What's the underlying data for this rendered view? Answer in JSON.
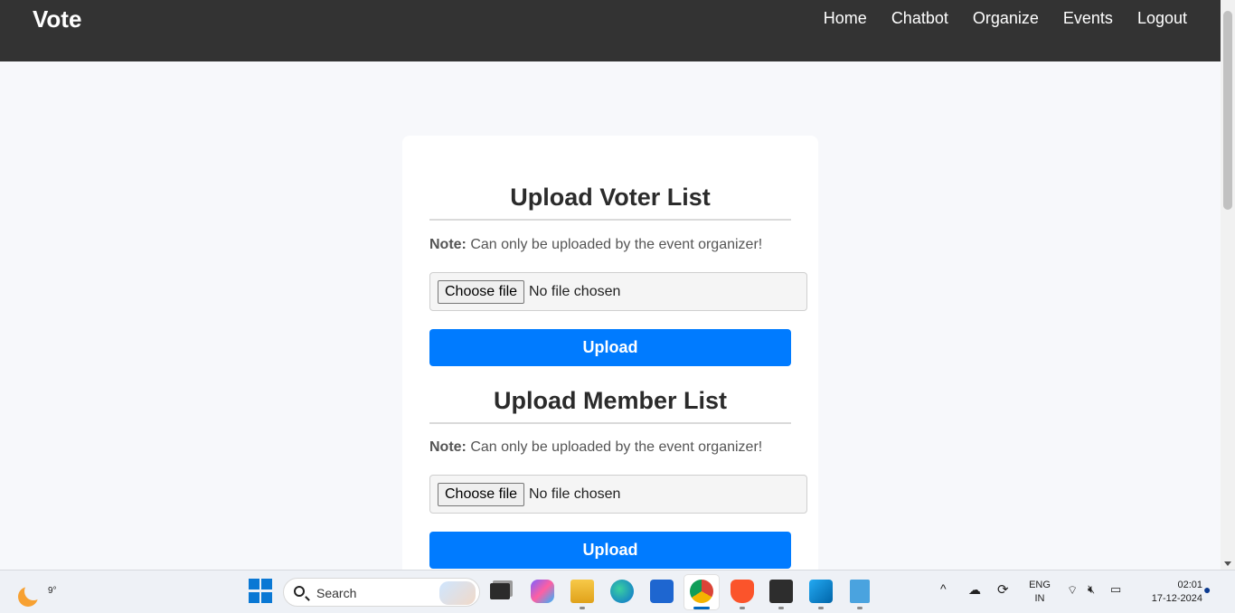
{
  "navbar": {
    "brand": "Vote",
    "links": [
      "Home",
      "Chatbot",
      "Organize",
      "Events",
      "Logout"
    ]
  },
  "sections": [
    {
      "title": "Upload Voter List",
      "note_label": "Note:",
      "note_text": " Can only be uploaded by the event organizer!",
      "file_button": "Choose file",
      "file_status": "No file chosen",
      "upload_label": "Upload"
    },
    {
      "title": "Upload Member List",
      "note_label": "Note:",
      "note_text": " Can only be uploaded by the event organizer!",
      "file_button": "Choose file",
      "file_status": "No file chosen",
      "upload_label": "Upload"
    }
  ],
  "taskbar": {
    "weather_temp": "9°",
    "search_label": "Search",
    "language": "ENG",
    "region": "IN",
    "time": "02:01",
    "date": "17-12-2024"
  },
  "colors": {
    "navbar_bg": "#333333",
    "accent": "#007bff",
    "page_bg": "#f7f8fb"
  }
}
